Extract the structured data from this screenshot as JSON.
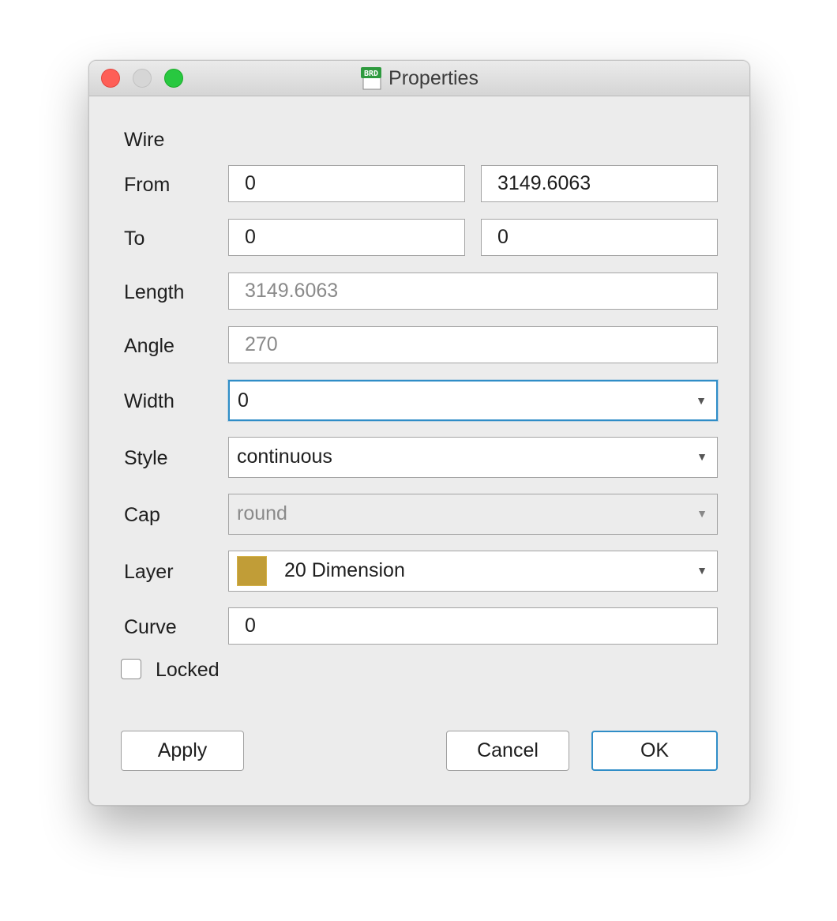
{
  "window": {
    "title": "Properties",
    "app_icon_text": "BRD"
  },
  "section": {
    "heading": "Wire"
  },
  "from": {
    "label": "From",
    "x": "0",
    "y": "3149.6063"
  },
  "to": {
    "label": "To",
    "x": "0",
    "y": "0"
  },
  "length": {
    "label": "Length",
    "value": "3149.6063"
  },
  "angle": {
    "label": "Angle",
    "value": "270"
  },
  "width": {
    "label": "Width",
    "value": "0"
  },
  "style": {
    "label": "Style",
    "value": "continuous"
  },
  "cap": {
    "label": "Cap",
    "value": "round"
  },
  "layer": {
    "label": "Layer",
    "value": "20 Dimension",
    "color": "#c19d37"
  },
  "curve": {
    "label": "Curve",
    "value": "0"
  },
  "locked": {
    "label": "Locked",
    "checked": false
  },
  "buttons": {
    "apply": "Apply",
    "cancel": "Cancel",
    "ok": "OK"
  },
  "icons": {
    "dropdown": "chevron-down-icon",
    "close": "close-icon",
    "minimize": "minimize-icon",
    "zoom": "zoom-icon",
    "app": "brd-document-icon"
  },
  "colors": {
    "window_bg": "#ececec",
    "focus_ring": "#2f8dc7",
    "close_light": "#fe5f57",
    "zoom_light": "#28c840"
  }
}
